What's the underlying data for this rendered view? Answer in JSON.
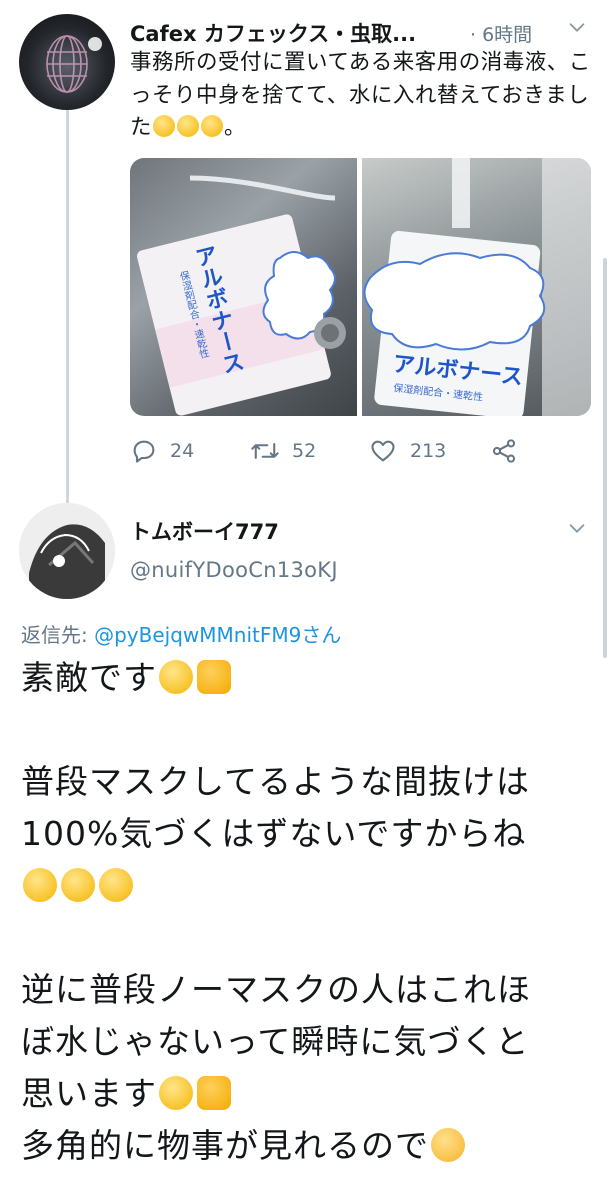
{
  "tweet1": {
    "display_name": "Cafex カフェックス・虫取...",
    "time": "· 6時間",
    "text": "事務所の受付に置いてある来客用の消毒液、こっそり中身を捨てて、水に入れ替えておきました",
    "text_end": "。",
    "emoji_count": 3,
    "photos": [
      {
        "label": "アルボナース",
        "sub": "保湿剤配合・速乾性"
      },
      {
        "label": "アルボナース",
        "sub": "保湿剤配合・速乾性"
      }
    ],
    "actions": {
      "reply_count": "24",
      "retweet_count": "52",
      "like_count": "213"
    }
  },
  "reply": {
    "display_name": "トムボーイ777",
    "handle": "@nuifYDooCn13oKJ",
    "replying_prefix": "返信先: ",
    "replying_to": "@pyBejqwMMnitFM9さん",
    "lines": {
      "l1": "素敵です",
      "l2": "普段マスクしてるような間抜けは",
      "l3": "100%気づくはずないですからね",
      "l4": "逆に普段ノーマスクの人はこれほ",
      "l5": "ぼ水じゃないって瞬時に気づくと",
      "l6": "思います",
      "l7": "多角的に物事が見れるので"
    }
  }
}
